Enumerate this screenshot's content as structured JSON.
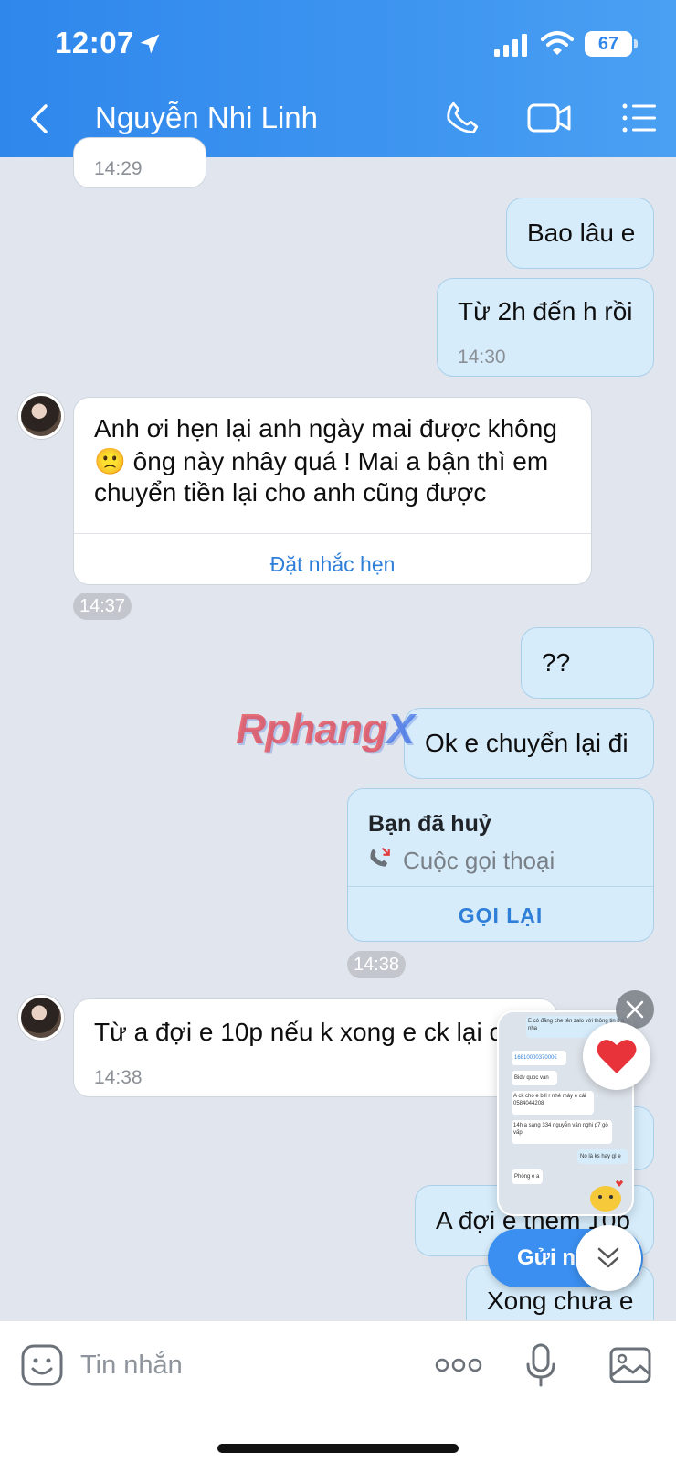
{
  "status_bar": {
    "time": "12:07",
    "battery": "67"
  },
  "header": {
    "title": "Nguyễn Nhi Linh",
    "back_icon": "chevron-left-icon",
    "call_icon": "phone-icon",
    "video_icon": "video-camera-icon",
    "menu_icon": "list-menu-icon"
  },
  "messages": {
    "m0": {
      "time": "14:29"
    },
    "m1": {
      "text": "Bao lâu e"
    },
    "m2": {
      "text": "Từ 2h đến h rồi",
      "time": "14:30"
    },
    "m3": {
      "line1": "Anh ơi hẹn lại anh ngày mai được không",
      "emoji": "🙁",
      "line2": "ông này nhây quá ! Mai a bận thì em",
      "line3": "chuyển tiền lại cho anh cũng được",
      "action": "Đặt nhắc hẹn",
      "time": "14:37"
    },
    "m4": {
      "text": "??"
    },
    "m5": {
      "text": "Ok e chuyển lại đi"
    },
    "m6": {
      "title": "Bạn đã huỷ",
      "subtitle": "Cuộc gọi thoại",
      "action": "GỌI LẠI",
      "time": "14:38"
    },
    "m7": {
      "text": "Từ a đợi e 10p nếu k xong e ck lại c",
      "time": "14:38"
    },
    "m8": {
      "text": "A đợi e thêm 10p"
    },
    "m9": {
      "text": "Xong chưa e"
    }
  },
  "watermark": {
    "part1": "Rphang",
    "part2": "X"
  },
  "floating": {
    "send_label": "Gửi n",
    "heart": "❤️",
    "mini_preview": {
      "l1": "E có đăng che tên zalo với thông tin k a nha",
      "l2": "1681000037000€",
      "l3": "Bidv quoc van",
      "l4": "A ck cho e bill r nhé máy e cái 0584044208",
      "l5": "14h a sang 334 nguyễn văn nghi p7 gò vấp",
      "l6": "Nó là ks hay gì e",
      "l7": "Phòng e a"
    }
  },
  "input_bar": {
    "placeholder": "Tin nhắn",
    "emoji_icon": "sticker-face-icon",
    "more_icon": "more-dots-icon",
    "mic_icon": "microphone-icon",
    "image_icon": "image-gallery-icon"
  }
}
